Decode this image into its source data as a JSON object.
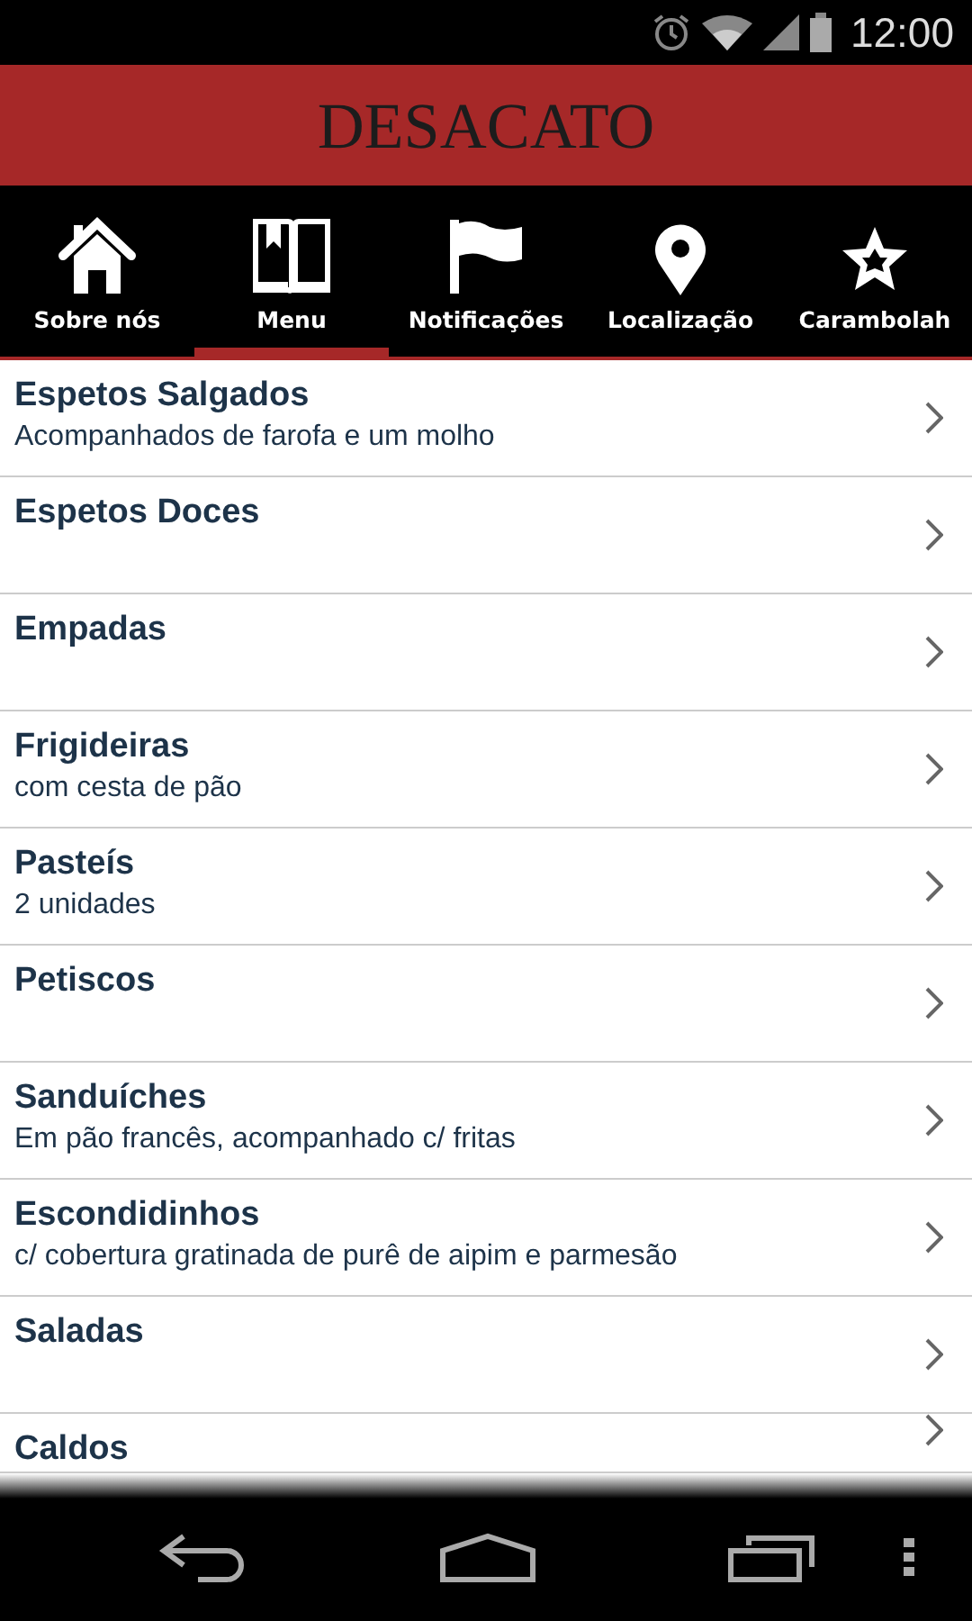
{
  "status_bar": {
    "time": "12:00"
  },
  "header": {
    "title": "DESACATO"
  },
  "tabs": [
    {
      "label": "Sobre nós",
      "selected": false
    },
    {
      "label": "Menu",
      "selected": true
    },
    {
      "label": "Notificações",
      "selected": false
    },
    {
      "label": "Localização",
      "selected": false
    },
    {
      "label": "Carambolah",
      "selected": false
    }
  ],
  "menu_items": [
    {
      "title": "Espetos Salgados",
      "subtitle": "Acompanhados de farofa e um molho"
    },
    {
      "title": "Espetos Doces"
    },
    {
      "title": "Empadas"
    },
    {
      "title": "Frigideiras",
      "subtitle": "com cesta de pão"
    },
    {
      "title": "Pasteís",
      "subtitle": "2 unidades"
    },
    {
      "title": "Petiscos"
    },
    {
      "title": "Sanduíches",
      "subtitle": "Em pão francês, acompanhado c/ fritas"
    },
    {
      "title": "Escondidinhos",
      "subtitle": "c/ cobertura gratinada de purê de aipim e parmesão"
    },
    {
      "title": "Saladas"
    },
    {
      "title": "Caldos"
    }
  ]
}
